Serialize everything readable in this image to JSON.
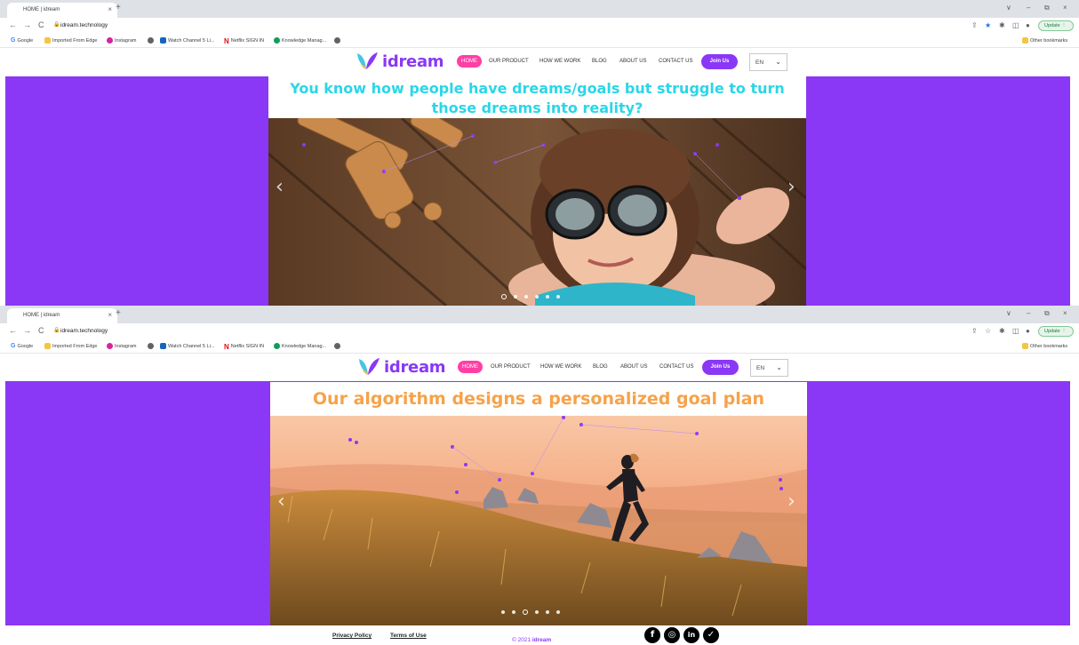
{
  "browser": {
    "tab_title": "HOME | idream",
    "tab_close": "×",
    "new_tab": "+",
    "url": "idream.technology",
    "update_label": "Update",
    "bookmarks": [
      "Google",
      "Imported From Edge",
      "Instagram",
      "Watch Channel 5 Li...",
      "Netflix SIGN IN",
      "Knowledge Manag..."
    ],
    "other_bookmarks": "Other bookmarks",
    "window_controls": [
      "∨",
      "–",
      "⧉",
      "×"
    ]
  },
  "site": {
    "logo_text": "idream",
    "nav": [
      "HOME",
      "OUR PRODUCT",
      "HOW WE WORK",
      "BLOG",
      "ABOUT US",
      "CONTACT US"
    ],
    "join_label": "Join Us",
    "language": "EN",
    "colors": {
      "purple": "#8a38f5",
      "pink": "#ff3fa4",
      "cyan": "#2ad6e8",
      "orange": "#f6a24a"
    }
  },
  "slide1": {
    "heading_line1": "You know how people have dreams/goals but struggle to turn",
    "heading_line2": "those dreams into reality?"
  },
  "slide2": {
    "heading": "Our algorithm  designs a personalized goal plan"
  },
  "carousel": {
    "prev": "‹",
    "next": "›",
    "dot_count": 6
  },
  "footer": {
    "privacy": "Privacy Policy",
    "terms": "Terms of Use",
    "copyright_prefix": "© 2021",
    "copyright_brand": "idream",
    "social": [
      {
        "icon": "facebook-icon",
        "glyph": "f"
      },
      {
        "icon": "instagram-icon",
        "glyph": "◎"
      },
      {
        "icon": "linkedin-icon",
        "glyph": "in"
      },
      {
        "icon": "twitter-icon",
        "glyph": "✓"
      }
    ]
  }
}
